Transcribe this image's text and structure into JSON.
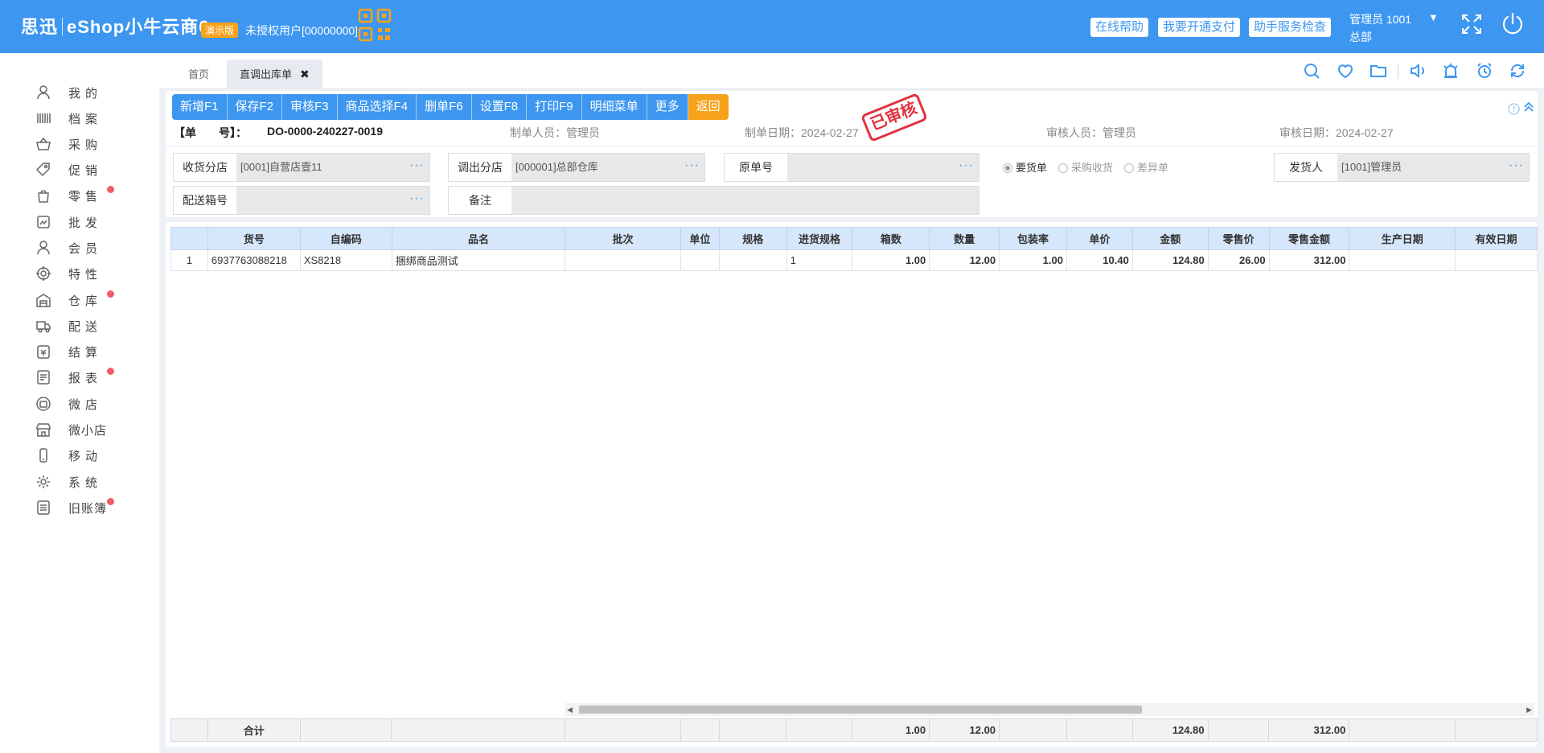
{
  "header": {
    "brand_cn": "思迅",
    "brand_app": "eShop小牛云商6",
    "demo_badge": "演示版",
    "license_text": "未授权用户[00000000]",
    "buttons": [
      "在线帮助",
      "我要开通支付",
      "助手服务检查"
    ],
    "user_name": "管理员 1001",
    "user_caret": "▼",
    "user_dept": "总部"
  },
  "sidebar": {
    "items": [
      {
        "label": "我的",
        "icon": "user-icon",
        "badge": false
      },
      {
        "label": "档案",
        "icon": "barcode-icon",
        "badge": false
      },
      {
        "label": "采购",
        "icon": "basket-icon",
        "badge": false
      },
      {
        "label": "促销",
        "icon": "tag-icon",
        "badge": false
      },
      {
        "label": "零售",
        "icon": "shopping-bag-icon",
        "badge": true
      },
      {
        "label": "批发",
        "icon": "wholesale-icon",
        "badge": false
      },
      {
        "label": "会员",
        "icon": "member-icon",
        "badge": false
      },
      {
        "label": "特性",
        "icon": "target-icon",
        "badge": false
      },
      {
        "label": "仓库",
        "icon": "warehouse-icon",
        "badge": true
      },
      {
        "label": "配送",
        "icon": "truck-icon",
        "badge": false
      },
      {
        "label": "结算",
        "icon": "settlement-icon",
        "badge": false
      },
      {
        "label": "报表",
        "icon": "report-icon",
        "badge": true
      },
      {
        "label": "微店",
        "icon": "micro-shop-icon",
        "badge": false
      },
      {
        "label": "微小店",
        "icon": "store-icon",
        "badge": false
      },
      {
        "label": "移动",
        "icon": "mobile-icon",
        "badge": false
      },
      {
        "label": "系统",
        "icon": "gear-icon",
        "badge": false
      },
      {
        "label": "旧账簿",
        "icon": "ledger-icon",
        "badge": true
      }
    ]
  },
  "tabs": {
    "home": "首页",
    "current": "直调出库单",
    "close": "✖"
  },
  "toolbar": {
    "buttons": [
      "新增F1",
      "保存F2",
      "审核F3",
      "商品选择F4",
      "删单F6",
      "设置F8",
      "打印F9",
      "明细菜单",
      "更多",
      "返回"
    ]
  },
  "doc_info": {
    "order_label": "【单　　号】：",
    "order_no": "DO-0000-240227-0019",
    "creator": "制单人员：管理员",
    "create_date": "制单日期：2024-02-27",
    "reviewer": "审核人员：管理员",
    "review_date": "审核日期：2024-02-27",
    "stamp": "已审核"
  },
  "form": {
    "receive_branch_label": "收货分店",
    "receive_branch_value": "[0001]自营店壹11",
    "out_branch_label": "调出分店",
    "out_branch_value": "[000001]总部仓库",
    "origin_no_label": "原单号",
    "origin_no_value": "",
    "shipper_label": "发货人",
    "shipper_value": "[1001]管理员",
    "box_no_label": "配送箱号",
    "box_no_value": "",
    "remark_label": "备注",
    "remark_value": "",
    "dots": "···",
    "radios": [
      {
        "label": "要货单",
        "checked": true
      },
      {
        "label": "采购收货",
        "checked": false
      },
      {
        "label": "差异单",
        "checked": false
      }
    ]
  },
  "grid": {
    "columns": [
      "",
      "货号",
      "自编码",
      "品名",
      "批次",
      "单位",
      "规格",
      "进货规格",
      "箱数",
      "数量",
      "包装率",
      "单价",
      "金额",
      "零售价",
      "零售金额",
      "生产日期",
      "有效日期"
    ],
    "rows": [
      [
        "1",
        "6937763088218",
        "XS8218",
        "捆绑商品测试",
        "",
        "",
        "",
        "1",
        "1.00",
        "12.00",
        "1.00",
        "10.40",
        "124.80",
        "26.00",
        "312.00",
        "",
        ""
      ]
    ],
    "footer": [
      "",
      "合计",
      "",
      "",
      "",
      "",
      "",
      "",
      "1.00",
      "12.00",
      "",
      "",
      "124.80",
      "",
      "312.00",
      "",
      ""
    ],
    "scroll_left": "◀",
    "scroll_right": "▶"
  },
  "colors": {
    "primary": "#3d97f0",
    "accent": "#f7a21b",
    "stamp": "#e1333f",
    "badge": "#f45b69"
  }
}
